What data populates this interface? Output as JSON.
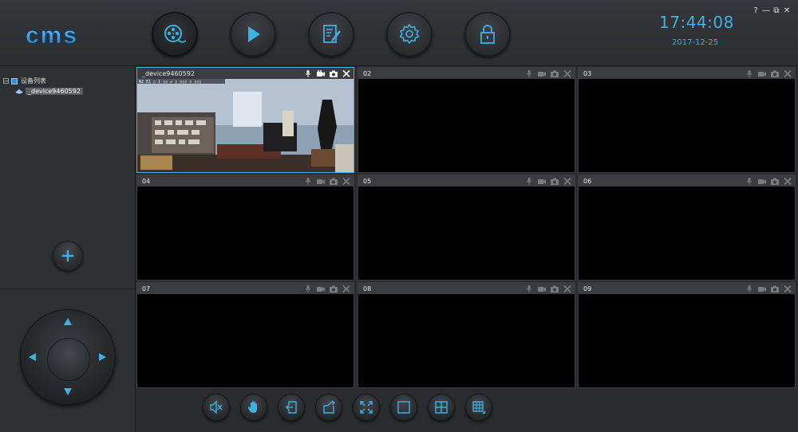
{
  "app": {
    "logo_text": "cms"
  },
  "header": {
    "nav": [
      {
        "name": "monitor",
        "icon": "film-reel-icon",
        "active": true
      },
      {
        "name": "playback",
        "icon": "play-icon",
        "active": false
      },
      {
        "name": "log",
        "icon": "edit-document-icon",
        "active": false
      },
      {
        "name": "settings",
        "icon": "gear-icon",
        "active": false
      },
      {
        "name": "lock",
        "icon": "lock-icon",
        "active": false
      }
    ],
    "time": "17:44:08",
    "date": "2017-12-25",
    "window_controls": [
      "?",
      "—",
      "⧉",
      "✕"
    ]
  },
  "device_tree": {
    "root_label": "设备列表",
    "root_toggle": "−",
    "devices": [
      {
        "label": "_device9460592",
        "selected": true
      }
    ]
  },
  "grid": {
    "cells": [
      {
        "title": "_device9460592",
        "has_video": true,
        "overlay_text": "W2 E1 ▯ 1 ▯▯ ✔ ▯ ▯▯▯ ▯ ▯▯▯"
      },
      {
        "title": "02"
      },
      {
        "title": "03"
      },
      {
        "title": "04"
      },
      {
        "title": "05"
      },
      {
        "title": "06"
      },
      {
        "title": "07"
      },
      {
        "title": "08"
      },
      {
        "title": "09"
      }
    ]
  },
  "toolbar": [
    {
      "name": "mute",
      "icon": "speaker-mute-icon"
    },
    {
      "name": "stop-all",
      "icon": "hand-icon"
    },
    {
      "name": "import",
      "icon": "import-icon"
    },
    {
      "name": "export",
      "icon": "export-icon"
    },
    {
      "name": "fullscreen",
      "icon": "fullscreen-icon"
    },
    {
      "name": "layout-1",
      "icon": "layout-single-icon"
    },
    {
      "name": "layout-4",
      "icon": "layout-quad-icon"
    },
    {
      "name": "layout-9",
      "icon": "layout-nine-icon"
    }
  ],
  "colors": {
    "accent": "#3fb1e0",
    "background": "#2b2c30",
    "cell": "#000000"
  }
}
